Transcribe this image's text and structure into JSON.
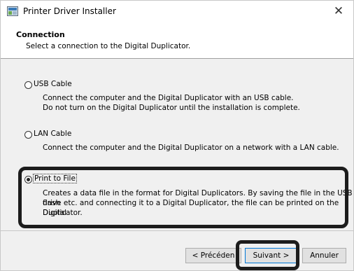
{
  "window": {
    "title": "Printer Driver Installer",
    "close_glyph": "✕"
  },
  "header": {
    "title": "Connection",
    "subtitle": "Select a connection to the Digital Duplicator."
  },
  "options": [
    {
      "label": "USB Cable",
      "desc1": "Connect the computer and the Digital Duplicator with an USB cable.",
      "desc2": "Do not turn on the Digital Duplicator until the installation is complete.",
      "selected": false
    },
    {
      "label": "LAN Cable",
      "desc1": "Connect the computer and the Digital Duplicator on a network with a LAN cable.",
      "selected": false
    },
    {
      "label": "Print to File",
      "desc1": "Creates a data file in the format for Digital Duplicators. By saving the file in the USB flash",
      "desc2": "drive etc. and connecting it to a Digital Duplicator, the file can be printed on the Digital",
      "desc3": "Duplicator.",
      "selected": true
    }
  ],
  "buttons": {
    "back": "< Précéden",
    "next": "Suivant >",
    "cancel": "Annuler"
  }
}
